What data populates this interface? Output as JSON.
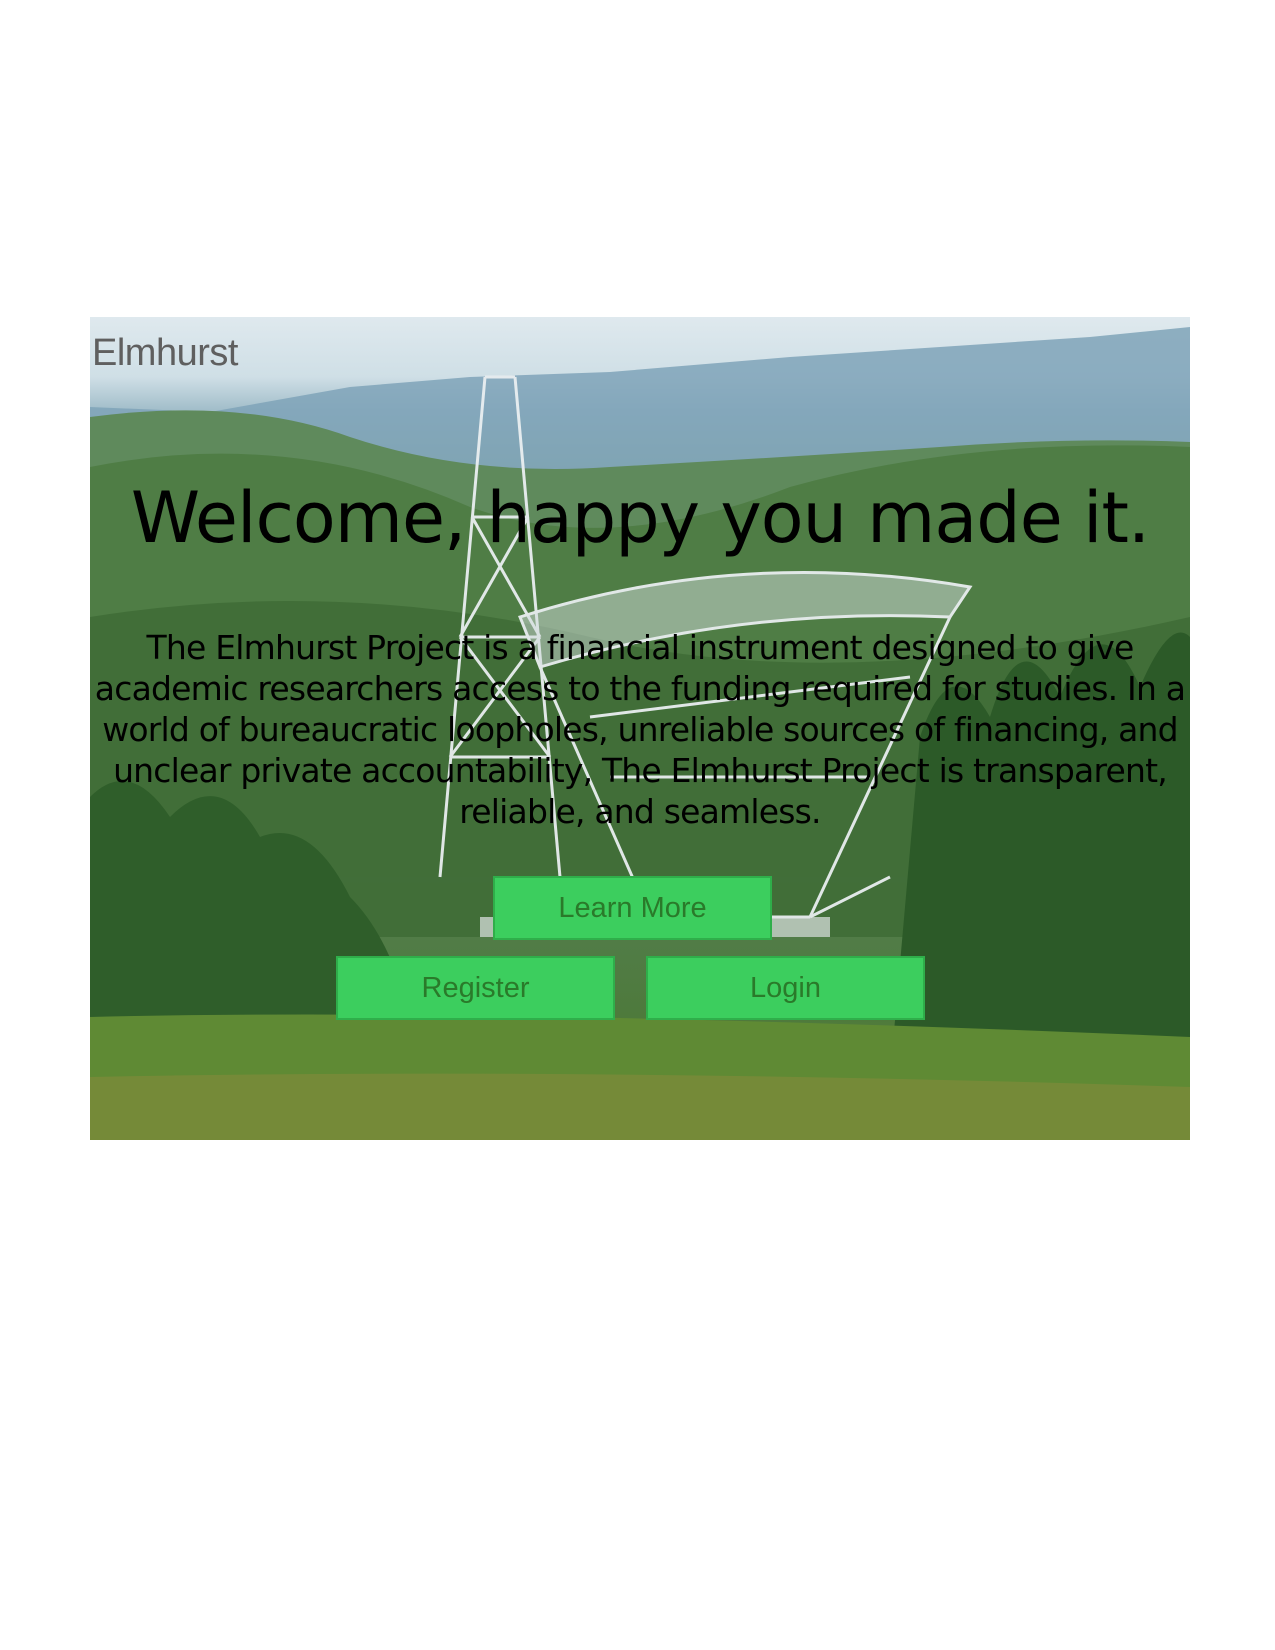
{
  "brand": {
    "name": "Elmhurst"
  },
  "hero": {
    "headline": "Welcome, happy you made it.",
    "blurb": "The Elmhurst Project is a financial instrument designed to give academic researchers access to the funding required for studies. In a world of bureaucratic loopholes, unreliable sources of financing, and unclear private accountability, The Elmhurst Project is transparent, reliable, and seamless.",
    "background_image": "radio-telescope-valley"
  },
  "actions": {
    "learn_more": "Learn More",
    "register": "Register",
    "login": "Login"
  },
  "colors": {
    "button_bg": "#3cce5e",
    "button_text": "#2a7a2a",
    "brand_text": "#5f5f5f"
  }
}
